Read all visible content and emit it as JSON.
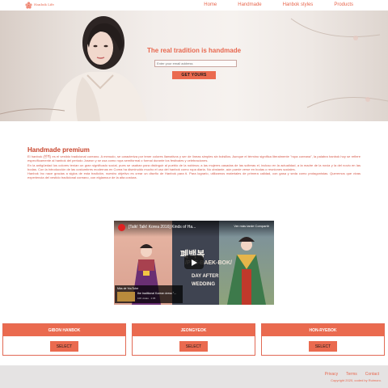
{
  "brand": {
    "name": "Hanbok Life",
    "accent": "#ea6a4f",
    "text_accent": "#e8674e"
  },
  "nav": {
    "items": [
      {
        "label": "Home"
      },
      {
        "label": "Handmade"
      },
      {
        "label": "Hanbok styles"
      },
      {
        "label": "Products"
      }
    ]
  },
  "hero": {
    "title": "The real tradition is handmade",
    "email_placeholder": "Enter your email address",
    "cta_label": "GET YOURS"
  },
  "about": {
    "title": "Handmade premium",
    "paragraphs": [
      "El hanbok (한복) es el vestido tradicional coreano. A menudo, se caracteriza por tener colores llamativos y ser de líneas simples sin bolsillos. Aunque el término significa literalmente \"ropa coreana\", la palabra hanbok hoy se refiere específicamente al hanbok del periodo Joseon y se usa como ropa semiformal o formal durante los festivales y celebraciones.",
      "En la antigüedad los colores tenían un gran significado social, pues se usaban para distinguir al pueblo de la nobleza; a las mujeres casadas de las solteras el, incluso en la actualidad, a la madre de la novia y la del novio en las bodas. Con la introducción de las costumbres modernas en Corea ha disminuido mucho el uso del hanbok como ropa diaria. No obstante, aún puede verse en bodas o reuniones sociales.",
      "Hanbok Inc nace gracias a siglos de esta tradición, nuestro objetivo es crear un diseño de Hanbok para ti. Para lograrlo, utilizamos materiales de primera calidad, con gasa y seda como protagonistas. Queremos que vivas experiencia del vestido tradicional coreano, con elglamour de la alta costura."
    ]
  },
  "video": {
    "title": "[Talk! Talk! Korea 2016] Kinds of Ha...",
    "share_label": "Ver más tarde   Compartir",
    "overlay_line1": "폐백복",
    "overlay_line2": "/PYE-BAEK-BOK/",
    "overlay_line3": "DAY AFTER",
    "overlay_line4": "WEDDING",
    "more_label": "Más de YouTube",
    "more_title": "the traditional Korean dress \"...",
    "more_meta": "10K vistas · 1:05"
  },
  "cards": [
    {
      "title": "GIBON HANBOK",
      "button": "SELECT"
    },
    {
      "title": "JEONGYEOK",
      "button": "SELECT"
    },
    {
      "title": "HON-RYEBOK",
      "button": "SELECT"
    }
  ],
  "footer": {
    "links": [
      {
        "label": "Privacy"
      },
      {
        "label": "Terms"
      },
      {
        "label": "Contact"
      }
    ],
    "copyright": "Copyright 2020, coded by Ruimoro."
  }
}
